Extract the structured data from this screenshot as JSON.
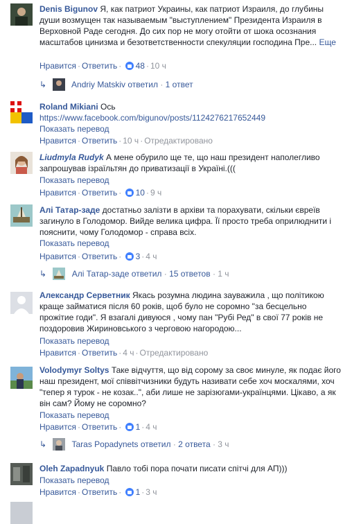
{
  "ui": {
    "like": "Нравится",
    "reply": "Ответить",
    "translate": "Показать перевод",
    "edited": "Отредактировано",
    "more": "Еще"
  },
  "comments": [
    {
      "author": "Denis Bigunov",
      "text": "Я, как патриот Украины, как патриот Израиля, до глубины души возмущен так называемым \"выступлением\" Президента Израиля в Верховной Раде сегодня. До сих пор не могу отойти от шока осознания масштабов цинизма и безответственности спекуляции господина Пре...",
      "likes": "48",
      "time": "10 ч",
      "reply_summary": {
        "name": "Andriy Matskiv ответил",
        "count": "1 ответ"
      }
    },
    {
      "author": "Roland Mikiani",
      "text": "Ось",
      "link": "https://www.facebook.com/bigunov/posts/1124276217652449",
      "time": "10 ч"
    },
    {
      "author": "Liudmyla Rudyk",
      "text": "А мене обурило ще те, що наш президент наполегливо запрошував ізраїльтян до приватизації в Україні.(((",
      "likes": "10",
      "time": "9 ч"
    },
    {
      "author": "Алі Татар-заде",
      "text": "достатньо залізти в архіви та порахувати, скільки євреїв загинуло в Голодомор. Вийде велика цифра. Її просто треба оприлюднити і пояснити, чому Голодомор - справа всіх.",
      "likes": "3",
      "time": "4 ч",
      "reply_summary": {
        "name": "Алі Татар-заде ответил",
        "count": "15 ответов",
        "time": "1 ч"
      }
    },
    {
      "author": "Александр Серветник",
      "text": "Якась розумна людина зауважила , що політикою краще займатися після 60 років, щоб було не соромно \"за бесцельно прожітие годи\". Я взагалі дивуюся , чому пан \"Рубі Ред\" в свої 77 років не поздоровив Жириновського з черговою нагородою...",
      "time": "4 ч"
    },
    {
      "author": "Volodymyr Soltys",
      "text": "Таке відчуття, що від сорому за своє минуле, як подає його наш президент, мої співвітчизники будуть називати себе хоч москалями, хоч \"тепер я турок - не козак..\", аби лише не зарізюгами-українцями. Цікаво, а як він сам? Йому не соромно?",
      "likes": "1",
      "time": "4 ч",
      "reply_summary": {
        "name": "Taras Popadynets ответил",
        "count": "2 ответа",
        "time": "3 ч"
      }
    },
    {
      "author": "Oleh Zapadnyuk",
      "text": "Павло тобі пора почати писати спітчі для АП)))",
      "likes": "1",
      "time": "3 ч"
    }
  ]
}
